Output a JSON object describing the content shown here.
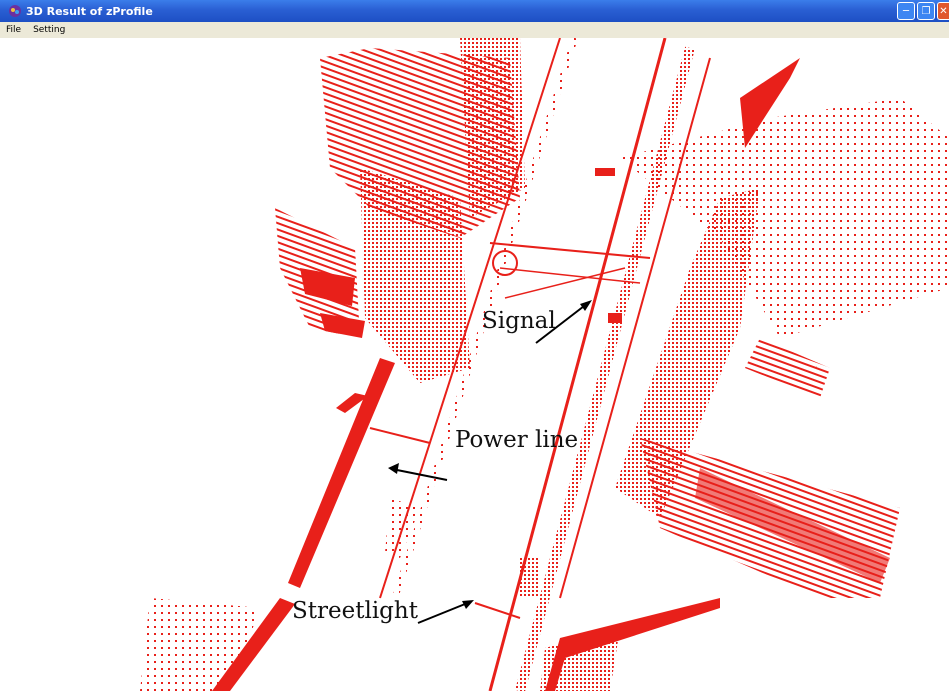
{
  "window": {
    "title": "3D Result of zProfile",
    "controls": {
      "minimize": "minimize-icon",
      "maximize": "maximize-icon",
      "close": "close-icon"
    }
  },
  "menu": {
    "items": [
      "File",
      "Setting"
    ]
  },
  "viewport": {
    "point_color": "#e8201a",
    "annotations": {
      "signal": "Signal",
      "power_line": "Power line",
      "streetlight": "Streetlight"
    }
  },
  "colors": {
    "titlebar": "#2a5fd3",
    "menubar": "#ece9d8",
    "points": "#e8201a"
  }
}
